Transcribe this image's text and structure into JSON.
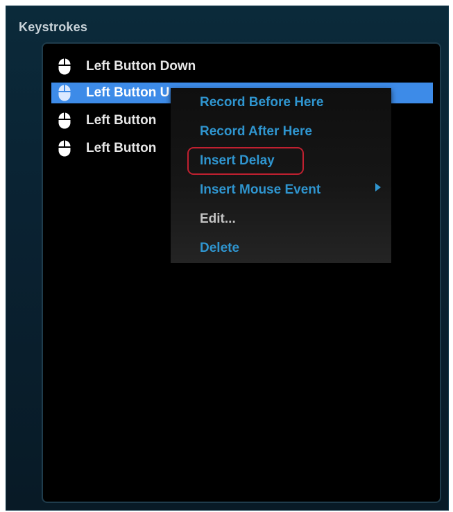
{
  "panel": {
    "title": "Keystrokes"
  },
  "keystrokes": {
    "items": [
      {
        "icon": "mouse-icon",
        "label": "Left Button Down",
        "selected": false
      },
      {
        "icon": "mouse-icon",
        "label": "Left Button U",
        "selected": true
      },
      {
        "icon": "mouse-icon",
        "label": "Left Button",
        "selected": false
      },
      {
        "icon": "mouse-icon",
        "label": "Left Button",
        "selected": false
      }
    ]
  },
  "context_menu": {
    "items": [
      {
        "label": "Record Before Here"
      },
      {
        "label": "Record After Here"
      },
      {
        "label": "Insert Delay",
        "highlighted": true
      },
      {
        "label": "Insert Mouse Event",
        "has_submenu": true,
        "submenu_icon": "triangle-right-icon"
      },
      {
        "label": "Edit...",
        "disabled": true
      },
      {
        "label": "Delete"
      }
    ]
  },
  "colors": {
    "accent": "#2f95cf",
    "selection": "#3d8be8",
    "highlight_ring": "#c02030"
  }
}
